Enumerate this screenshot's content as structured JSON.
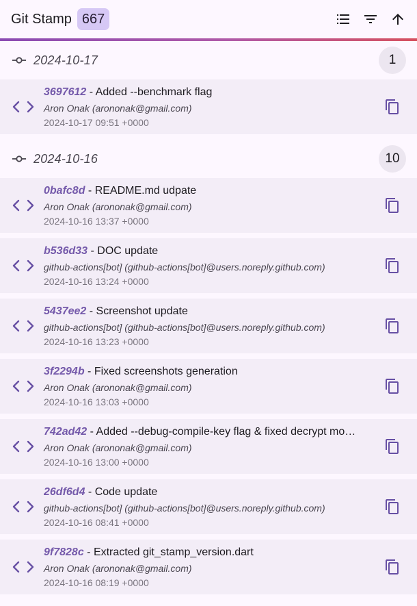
{
  "appbar": {
    "title": "Git Stamp",
    "count": "667",
    "actions": [
      "list-icon",
      "filter-icon",
      "arrow-up-icon"
    ]
  },
  "colors": {
    "accent": "#6750a4",
    "hash": "#7459aa",
    "row_bg": "#f3edf7",
    "badge_bg": "#d6c8f5",
    "gradient": [
      "#8b4bb3",
      "#d6505f"
    ]
  },
  "groups": [
    {
      "date": "2024-10-17",
      "count": "1",
      "commits": [
        {
          "hash": "3697612",
          "message": "Added --benchmark flag",
          "author": "Aron Onak (arononak@gmail.com)",
          "time": "2024-10-17 09:51 +0000"
        }
      ]
    },
    {
      "date": "2024-10-16",
      "count": "10",
      "commits": [
        {
          "hash": "0bafc8d",
          "message": "README.md udpate",
          "author": "Aron Onak (arononak@gmail.com)",
          "time": "2024-10-16 13:37 +0000"
        },
        {
          "hash": "b536d33",
          "message": "DOC update",
          "author": "github-actions[bot] (github-actions[bot]@users.noreply.github.com)",
          "time": "2024-10-16 13:24 +0000"
        },
        {
          "hash": "5437ee2",
          "message": "Screenshot update",
          "author": "github-actions[bot] (github-actions[bot]@users.noreply.github.com)",
          "time": "2024-10-16 13:23 +0000"
        },
        {
          "hash": "3f2294b",
          "message": "Fixed screenshots generation",
          "author": "Aron Onak (arononak@gmail.com)",
          "time": "2024-10-16 13:03 +0000"
        },
        {
          "hash": "742ad42",
          "message": "Added --debug-compile-key flag & fixed decrypt mo…",
          "author": "Aron Onak (arononak@gmail.com)",
          "time": "2024-10-16 13:00 +0000"
        },
        {
          "hash": "26df6d4",
          "message": "Code update",
          "author": "github-actions[bot] (github-actions[bot]@users.noreply.github.com)",
          "time": "2024-10-16 08:41 +0000"
        },
        {
          "hash": "9f7828c",
          "message": "Extracted git_stamp_version.dart",
          "author": "Aron Onak (arononak@gmail.com)",
          "time": "2024-10-16 08:19 +0000"
        }
      ]
    }
  ]
}
